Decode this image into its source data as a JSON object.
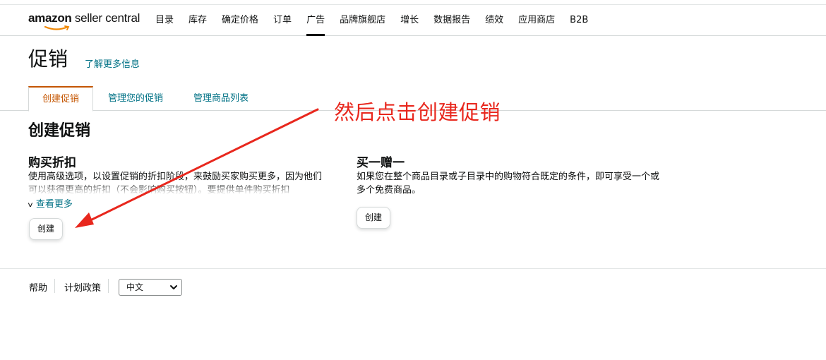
{
  "topnav": {
    "logo": {
      "brand": "amazon",
      "suffix": " seller central"
    },
    "items": [
      {
        "label": "目录",
        "active": false
      },
      {
        "label": "库存",
        "active": false
      },
      {
        "label": "确定价格",
        "active": false
      },
      {
        "label": "订单",
        "active": false
      },
      {
        "label": "广告",
        "active": true
      },
      {
        "label": "品牌旗舰店",
        "active": false
      },
      {
        "label": "增长",
        "active": false
      },
      {
        "label": "数据报告",
        "active": false
      },
      {
        "label": "绩效",
        "active": false
      },
      {
        "label": "应用商店",
        "active": false
      },
      {
        "label": "B2B",
        "active": false
      }
    ]
  },
  "page": {
    "title": "促销",
    "learn_more": "了解更多信息"
  },
  "tabs": [
    {
      "label": "创建促销",
      "active": true
    },
    {
      "label": "管理您的促销",
      "active": false
    },
    {
      "label": "管理商品列表",
      "active": false
    }
  ],
  "section": {
    "title": "创建促销"
  },
  "cards": [
    {
      "title": "购买折扣",
      "description": "使用高级选项，以设置促销的折扣阶段，来鼓励买家购买更多，因为他们可以获得更高的折扣（不会影响购买按钮）。要提供单件购买折扣",
      "see_more": "查看更多",
      "button": "创建"
    },
    {
      "title": "买一赠一",
      "description": "如果您在整个商品目录或子目录中的购物符合既定的条件，即可享受一个或多个免费商品。",
      "button": "创建"
    }
  ],
  "footer": {
    "help": "帮助",
    "policy": "计划政策",
    "language": "中文"
  },
  "annotation": {
    "text": "然后点击创建促销",
    "color": "#e8271d"
  },
  "colors": {
    "link": "#007185",
    "active_tab": "#c45500"
  }
}
